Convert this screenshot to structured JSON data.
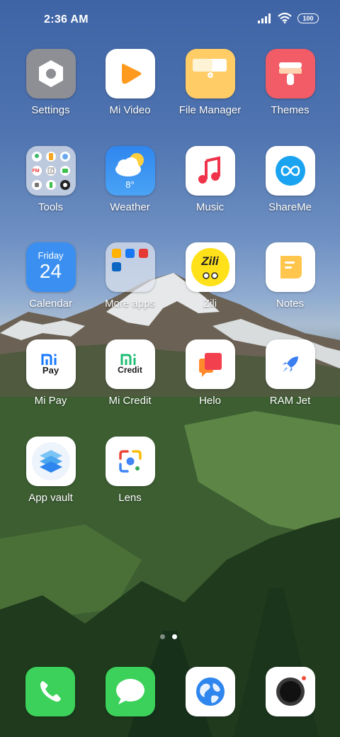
{
  "status_bar": {
    "time": "2:36 AM",
    "battery": "100",
    "signal_icon": "signal-icon",
    "wifi_icon": "wifi-icon"
  },
  "apps": {
    "settings": "Settings",
    "mi_video": "Mi Video",
    "file_manager": "File Manager",
    "themes": "Themes",
    "tools": "Tools",
    "weather": "Weather",
    "music": "Music",
    "shareme": "ShareMe",
    "calendar": "Calendar",
    "more_apps": "More apps",
    "zili": "Zili",
    "notes": "Notes",
    "mi_pay": "Mi Pay",
    "mi_credit": "Mi Credit",
    "helo": "Helo",
    "ram_jet": "RAM Jet",
    "app_vault": "App vault",
    "lens": "Lens"
  },
  "icon_text": {
    "weather_temp": "8°",
    "calendar_day": "Friday",
    "calendar_date": "24",
    "zili_logo": "Zili",
    "mi_pay_logo": "Pay",
    "mi_credit_logo": "Credit"
  },
  "tools_folder_glyphs": [
    "FM",
    "✆"
  ],
  "page_indicator": {
    "count": 2,
    "active": 2
  },
  "dock": [
    "phone-icon",
    "messages-icon",
    "browser-icon",
    "camera-icon"
  ],
  "colors": {
    "settings_bg": "#8e8f94",
    "mi_video_accent": "#ff9a1f",
    "file_manager_bg": "#ffcc66",
    "themes_bg": "#f25c67",
    "weather_bg": "#3a8ff0",
    "music_accent": "#f0334a",
    "shareme_accent": "#1aa3f0",
    "calendar_bg": "#3a8ff0",
    "notes_accent": "#ffc54d",
    "dock_green": "#3cd15a"
  }
}
